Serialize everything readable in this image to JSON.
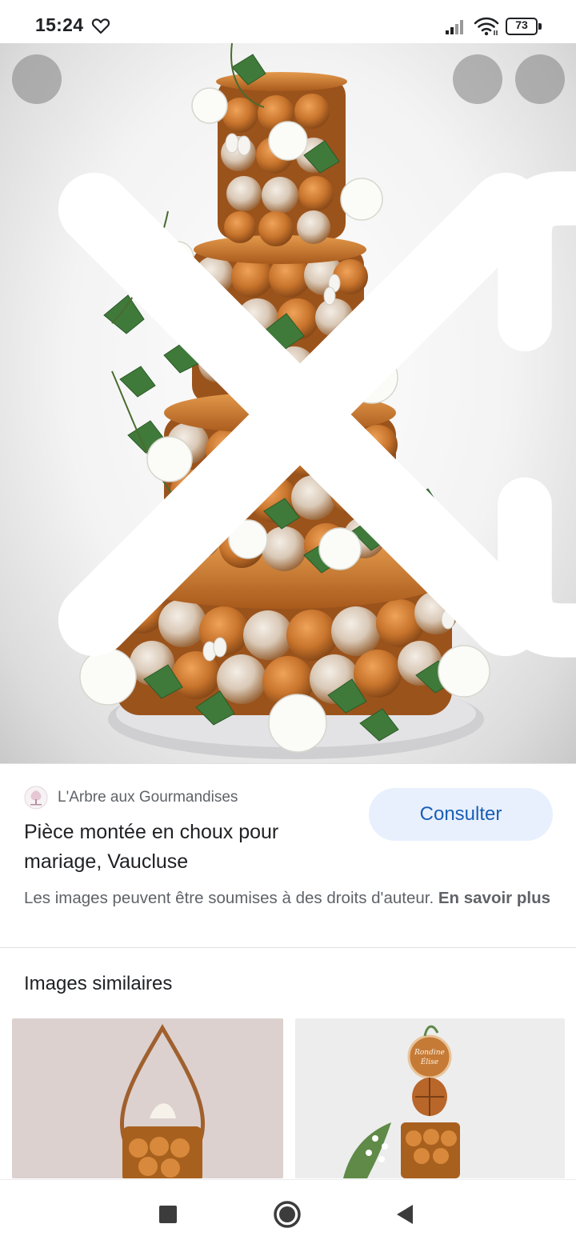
{
  "status_bar": {
    "time": "15:24",
    "battery_level": "73",
    "icons": [
      "heart-outline-icon",
      "signal-icon",
      "wifi-icon",
      "battery-icon"
    ]
  },
  "viewer": {
    "close_icon": "close-icon",
    "lens_icon": "lens-icon",
    "more_icon": "more-vert-icon"
  },
  "result": {
    "source_name": "L'Arbre aux Gourmandises",
    "action_label": "Consulter",
    "title": "Pièce montée en choux pour mariage, Vaucluse",
    "copyright_text": "Les images peuvent être soumises à des droits d'auteur.",
    "learn_more_label": "En savoir plus"
  },
  "similar": {
    "heading": "Images similaires",
    "thumbnails": [
      {
        "background": "#dcd1cf"
      },
      {
        "background": "#ededee"
      }
    ]
  },
  "nav_bar": {
    "icons": [
      "recents-square-icon",
      "home-circle-icon",
      "back-triangle-icon"
    ]
  },
  "colors": {
    "accent": "#1a5fb4",
    "button_bg": "#e8f0fe",
    "text_primary": "#202124",
    "text_secondary": "#5f6368",
    "caramel": "#c8742c"
  }
}
